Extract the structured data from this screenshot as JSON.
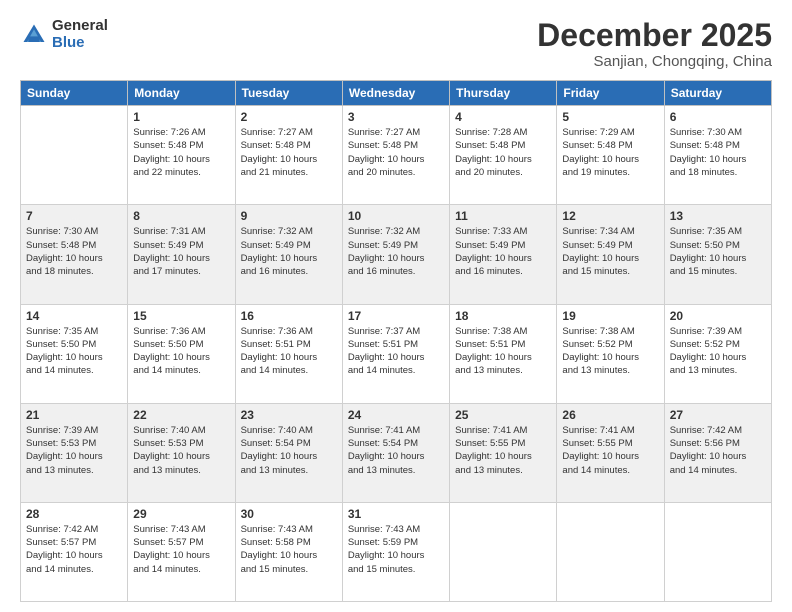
{
  "logo": {
    "general": "General",
    "blue": "Blue"
  },
  "header": {
    "month": "December 2025",
    "location": "Sanjian, Chongqing, China"
  },
  "weekdays": [
    "Sunday",
    "Monday",
    "Tuesday",
    "Wednesday",
    "Thursday",
    "Friday",
    "Saturday"
  ],
  "weeks": [
    [
      {
        "day": "",
        "info": ""
      },
      {
        "day": "1",
        "info": "Sunrise: 7:26 AM\nSunset: 5:48 PM\nDaylight: 10 hours\nand 22 minutes."
      },
      {
        "day": "2",
        "info": "Sunrise: 7:27 AM\nSunset: 5:48 PM\nDaylight: 10 hours\nand 21 minutes."
      },
      {
        "day": "3",
        "info": "Sunrise: 7:27 AM\nSunset: 5:48 PM\nDaylight: 10 hours\nand 20 minutes."
      },
      {
        "day": "4",
        "info": "Sunrise: 7:28 AM\nSunset: 5:48 PM\nDaylight: 10 hours\nand 20 minutes."
      },
      {
        "day": "5",
        "info": "Sunrise: 7:29 AM\nSunset: 5:48 PM\nDaylight: 10 hours\nand 19 minutes."
      },
      {
        "day": "6",
        "info": "Sunrise: 7:30 AM\nSunset: 5:48 PM\nDaylight: 10 hours\nand 18 minutes."
      }
    ],
    [
      {
        "day": "7",
        "info": "Sunrise: 7:30 AM\nSunset: 5:48 PM\nDaylight: 10 hours\nand 18 minutes."
      },
      {
        "day": "8",
        "info": "Sunrise: 7:31 AM\nSunset: 5:49 PM\nDaylight: 10 hours\nand 17 minutes."
      },
      {
        "day": "9",
        "info": "Sunrise: 7:32 AM\nSunset: 5:49 PM\nDaylight: 10 hours\nand 16 minutes."
      },
      {
        "day": "10",
        "info": "Sunrise: 7:32 AM\nSunset: 5:49 PM\nDaylight: 10 hours\nand 16 minutes."
      },
      {
        "day": "11",
        "info": "Sunrise: 7:33 AM\nSunset: 5:49 PM\nDaylight: 10 hours\nand 16 minutes."
      },
      {
        "day": "12",
        "info": "Sunrise: 7:34 AM\nSunset: 5:49 PM\nDaylight: 10 hours\nand 15 minutes."
      },
      {
        "day": "13",
        "info": "Sunrise: 7:35 AM\nSunset: 5:50 PM\nDaylight: 10 hours\nand 15 minutes."
      }
    ],
    [
      {
        "day": "14",
        "info": "Sunrise: 7:35 AM\nSunset: 5:50 PM\nDaylight: 10 hours\nand 14 minutes."
      },
      {
        "day": "15",
        "info": "Sunrise: 7:36 AM\nSunset: 5:50 PM\nDaylight: 10 hours\nand 14 minutes."
      },
      {
        "day": "16",
        "info": "Sunrise: 7:36 AM\nSunset: 5:51 PM\nDaylight: 10 hours\nand 14 minutes."
      },
      {
        "day": "17",
        "info": "Sunrise: 7:37 AM\nSunset: 5:51 PM\nDaylight: 10 hours\nand 14 minutes."
      },
      {
        "day": "18",
        "info": "Sunrise: 7:38 AM\nSunset: 5:51 PM\nDaylight: 10 hours\nand 13 minutes."
      },
      {
        "day": "19",
        "info": "Sunrise: 7:38 AM\nSunset: 5:52 PM\nDaylight: 10 hours\nand 13 minutes."
      },
      {
        "day": "20",
        "info": "Sunrise: 7:39 AM\nSunset: 5:52 PM\nDaylight: 10 hours\nand 13 minutes."
      }
    ],
    [
      {
        "day": "21",
        "info": "Sunrise: 7:39 AM\nSunset: 5:53 PM\nDaylight: 10 hours\nand 13 minutes."
      },
      {
        "day": "22",
        "info": "Sunrise: 7:40 AM\nSunset: 5:53 PM\nDaylight: 10 hours\nand 13 minutes."
      },
      {
        "day": "23",
        "info": "Sunrise: 7:40 AM\nSunset: 5:54 PM\nDaylight: 10 hours\nand 13 minutes."
      },
      {
        "day": "24",
        "info": "Sunrise: 7:41 AM\nSunset: 5:54 PM\nDaylight: 10 hours\nand 13 minutes."
      },
      {
        "day": "25",
        "info": "Sunrise: 7:41 AM\nSunset: 5:55 PM\nDaylight: 10 hours\nand 13 minutes."
      },
      {
        "day": "26",
        "info": "Sunrise: 7:41 AM\nSunset: 5:55 PM\nDaylight: 10 hours\nand 14 minutes."
      },
      {
        "day": "27",
        "info": "Sunrise: 7:42 AM\nSunset: 5:56 PM\nDaylight: 10 hours\nand 14 minutes."
      }
    ],
    [
      {
        "day": "28",
        "info": "Sunrise: 7:42 AM\nSunset: 5:57 PM\nDaylight: 10 hours\nand 14 minutes."
      },
      {
        "day": "29",
        "info": "Sunrise: 7:43 AM\nSunset: 5:57 PM\nDaylight: 10 hours\nand 14 minutes."
      },
      {
        "day": "30",
        "info": "Sunrise: 7:43 AM\nSunset: 5:58 PM\nDaylight: 10 hours\nand 15 minutes."
      },
      {
        "day": "31",
        "info": "Sunrise: 7:43 AM\nSunset: 5:59 PM\nDaylight: 10 hours\nand 15 minutes."
      },
      {
        "day": "",
        "info": ""
      },
      {
        "day": "",
        "info": ""
      },
      {
        "day": "",
        "info": ""
      }
    ]
  ]
}
